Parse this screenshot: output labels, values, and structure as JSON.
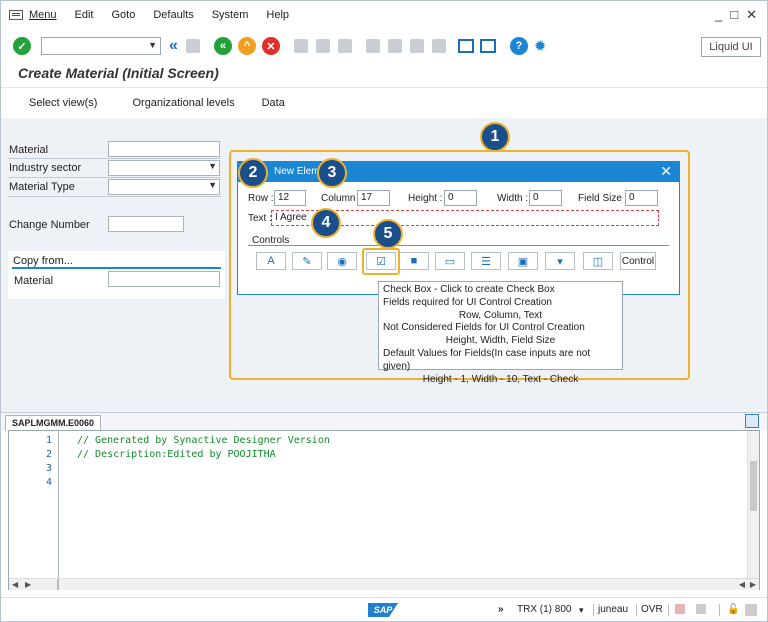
{
  "menu": [
    "Menu",
    "Edit",
    "Goto",
    "Defaults",
    "System",
    "Help"
  ],
  "window_controls": [
    "_",
    "□",
    "✕"
  ],
  "toolbar": {
    "liquid_ui": "Liquid UI"
  },
  "title": "Create Material (Initial Screen)",
  "appbar": [
    "Select view(s)",
    "Organizational levels",
    "Data"
  ],
  "form": {
    "material": "Material",
    "industry_sector": "Industry sector",
    "material_type": "Material Type",
    "change_number": "Change Number",
    "copy_from": "Copy from...",
    "copy_material": "Material"
  },
  "dialog": {
    "title": "New Element",
    "row_label": "Row :",
    "row_value": "12",
    "column_label": "Column :",
    "column_value": "17",
    "height_label": "Height :",
    "height_value": "0",
    "width_label": "Width :",
    "width_value": "0",
    "fieldsize_label": "Field Size :",
    "fieldsize_value": "0",
    "text_label": "Text :",
    "text_value": "I Agree",
    "controls_label": "Controls",
    "control_button": "Control"
  },
  "tooltip": [
    "Check Box - Click to create Check Box",
    "Fields required for UI Control Creation",
    "Row, Column, Text",
    "Not Considered Fields for UI Control Creation",
    "Height, Width, Field Size",
    "Default Values for Fields(In case inputs are not given)",
    "Height - 1, Width - 10, Text - Check"
  ],
  "badges": [
    "1",
    "2",
    "3",
    "4",
    "5"
  ],
  "editor": {
    "tab": "SAPLMGMM.E0060",
    "lines": [
      "1",
      "2",
      "3",
      "4"
    ],
    "code": [
      "// Generated by Synactive Designer Version",
      "// Description:Edited by POOJITHA",
      "",
      ""
    ]
  },
  "status": {
    "logo": "SAP",
    "chevrons": "»",
    "trx": "TRX (1) 800",
    "user": "juneau",
    "mode": "OVR"
  },
  "colors": {
    "accent": "#1a86d4",
    "callout": "#f0b12a",
    "badge": "#1b4f8c"
  }
}
